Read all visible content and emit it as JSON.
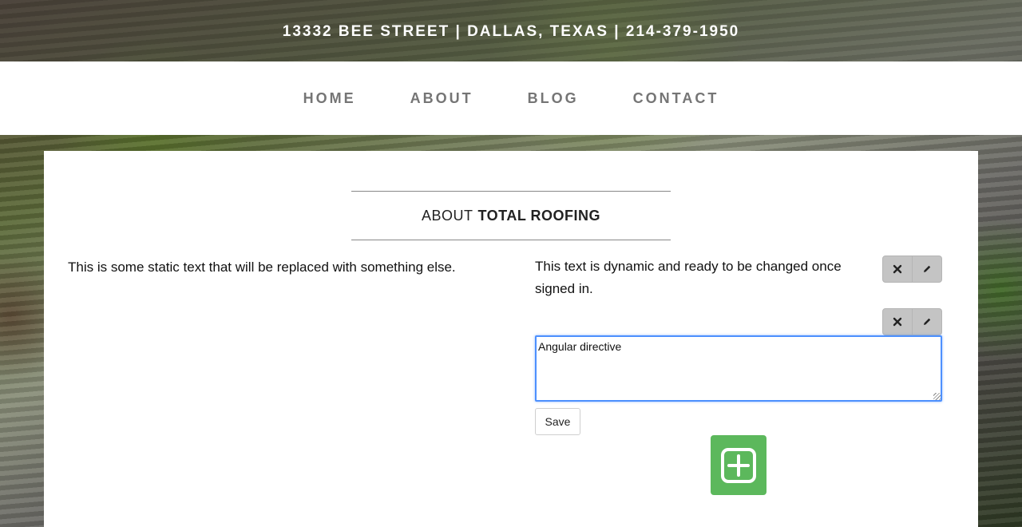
{
  "topbar": {
    "address": "13332 BEE STREET | DALLAS, TEXAS | 214-379-1950"
  },
  "nav": {
    "items": [
      {
        "label": "HOME"
      },
      {
        "label": "ABOUT"
      },
      {
        "label": "BLOG"
      },
      {
        "label": "CONTACT"
      }
    ]
  },
  "section": {
    "heading_prefix": "ABOUT",
    "heading_bold": "TOTAL ROOFING"
  },
  "static": {
    "text": "This is some static text that will be replaced with something else."
  },
  "dynamic": {
    "text": "This text is dynamic and ready to be changed once signed in.",
    "editor_value": "Angular directive",
    "save_label": "Save"
  },
  "icons": {
    "delete": "close-icon",
    "edit": "pencil-icon",
    "add": "plus-square-icon"
  },
  "colors": {
    "add_button": "#5cb85c",
    "editor_focus": "#4d90fe",
    "icon_button": "#c4c4c4"
  }
}
